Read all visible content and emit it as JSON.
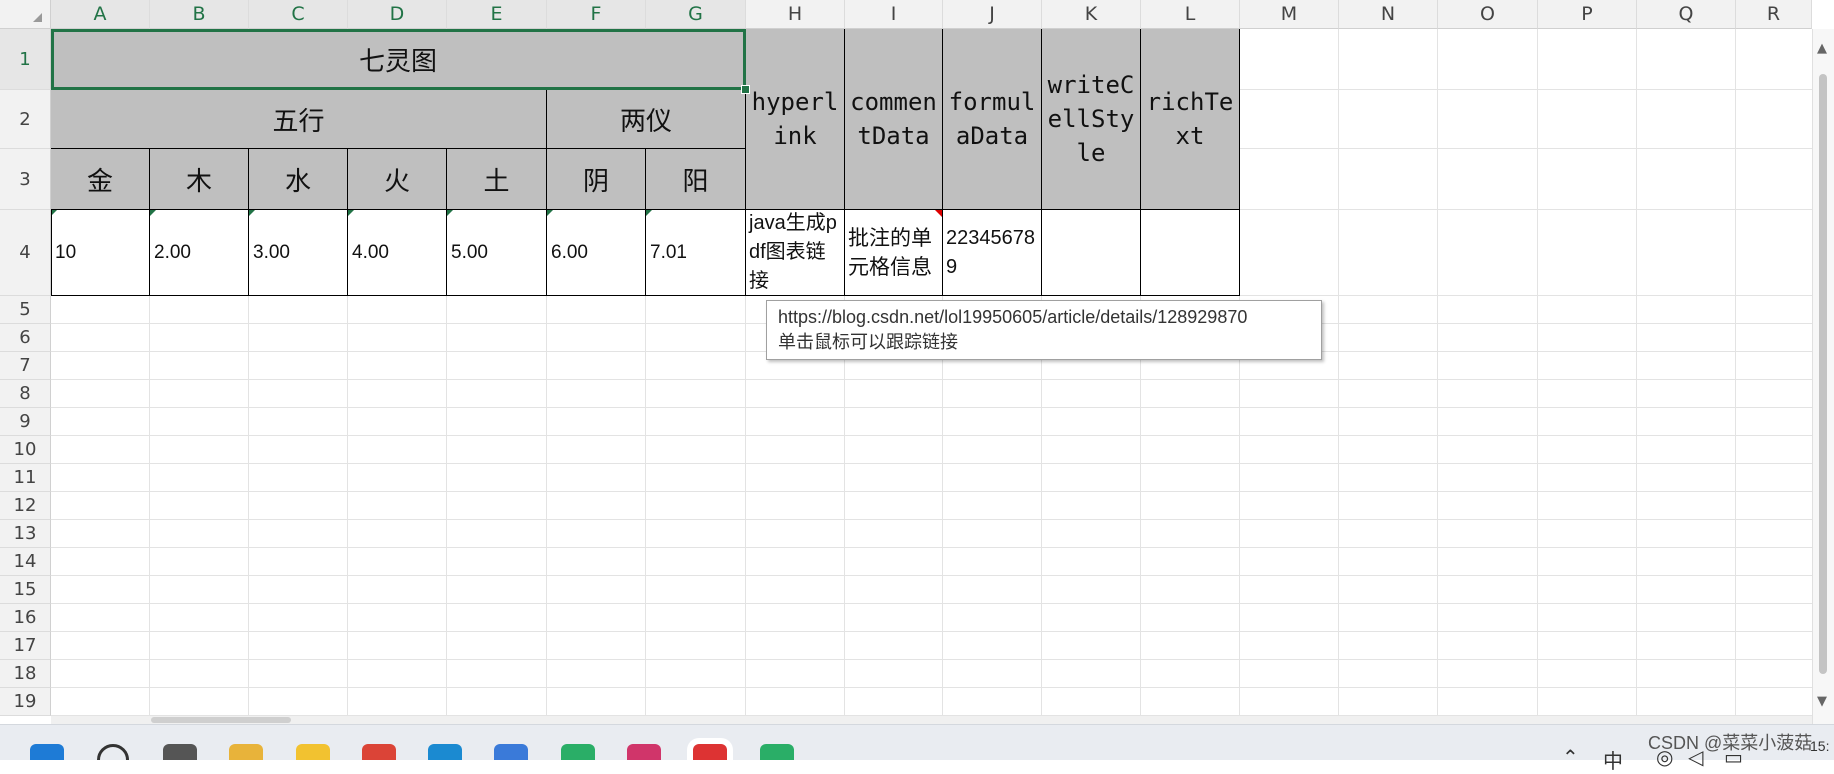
{
  "columns": [
    "A",
    "B",
    "C",
    "D",
    "E",
    "F",
    "G",
    "H",
    "I",
    "J",
    "K",
    "L",
    "M",
    "N",
    "O",
    "P",
    "Q",
    "R"
  ],
  "selected_columns": [
    "A",
    "B",
    "C",
    "D",
    "E",
    "F",
    "G"
  ],
  "rows": [
    "1",
    "2",
    "3",
    "4",
    "5",
    "6",
    "7",
    "8",
    "9",
    "10",
    "11",
    "12",
    "13",
    "14",
    "15",
    "16",
    "17",
    "18",
    "19"
  ],
  "selected_row": "1",
  "header": {
    "title": "七灵图",
    "wuxing": "五行",
    "liangyi": "两仪",
    "elements": [
      "金",
      "木",
      "水",
      "火",
      "土",
      "阴",
      "阳"
    ],
    "hyperlink": "hyperlink",
    "commentData": "commentData",
    "formulaData": "formulaData",
    "writeCellStyle": "writeCellStyle",
    "richText": "richText"
  },
  "row4": {
    "values": [
      "10",
      "2.00",
      "3.00",
      "4.00",
      "5.00",
      "6.00",
      "7.01"
    ],
    "hyperlink_text": "java生成pdf图表链接",
    "comment_text": "批注的单元格信息",
    "formula_value": "223456789",
    "writeCellStyle": "",
    "richText": ""
  },
  "tooltip": {
    "url": "https://blog.csdn.net/lol19950605/article/details/128929870",
    "hint": "单击鼠标可以跟踪链接"
  },
  "taskbar": {
    "icons": [
      "windows-start-icon",
      "search-icon",
      "task-view-icon",
      "file-explorer-icon",
      "app-icon",
      "chrome-icon",
      "edge-icon",
      "app-icon-2",
      "wechat-icon",
      "intellij-icon",
      "wps-icon",
      "app-icon-3"
    ],
    "watermark": "CSDN @菜菜小菠菇",
    "ime": "中",
    "time": "15:"
  },
  "colors": {
    "accent": "#217346",
    "header_fill": "#bfbfbf",
    "comment_marker": "#dd0000"
  }
}
